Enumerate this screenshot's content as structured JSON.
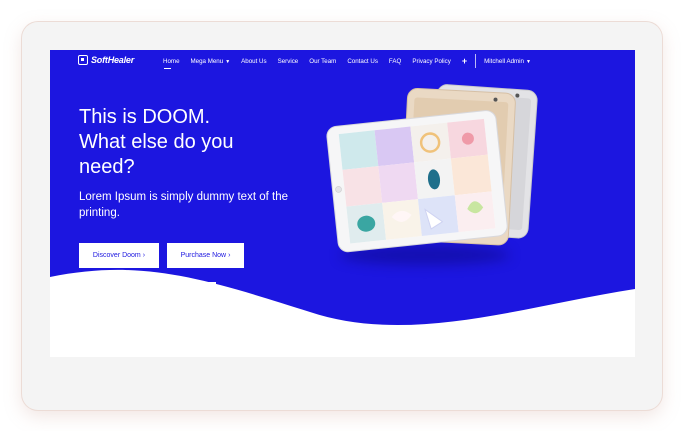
{
  "nav": {
    "logo": "SoftHealer",
    "items": [
      {
        "label": "Home",
        "active": true,
        "dropdown": false
      },
      {
        "label": "Mega Menu",
        "active": false,
        "dropdown": true
      },
      {
        "label": "About Us",
        "active": false,
        "dropdown": false
      },
      {
        "label": "Service",
        "active": false,
        "dropdown": false
      },
      {
        "label": "Our Team",
        "active": false,
        "dropdown": false
      },
      {
        "label": "Contact Us",
        "active": false,
        "dropdown": false
      },
      {
        "label": "FAQ",
        "active": false,
        "dropdown": false
      },
      {
        "label": "Privacy Policy",
        "active": false,
        "dropdown": false
      }
    ],
    "plus": "+",
    "user": "Mitchell Admin"
  },
  "hero": {
    "headline_lines": [
      "This is DOOM.",
      "What else do you",
      "need?"
    ],
    "subtitle_lines": [
      "Lorem Ipsum is simply dummy text of the",
      "printing."
    ],
    "primary_button": "Discover Doom",
    "secondary_button": "Purchase Now",
    "button_arrow": "›",
    "slides_total": 3,
    "slide_active": 3
  },
  "colors": {
    "brand": "#1c16e0",
    "white": "#ffffff"
  }
}
